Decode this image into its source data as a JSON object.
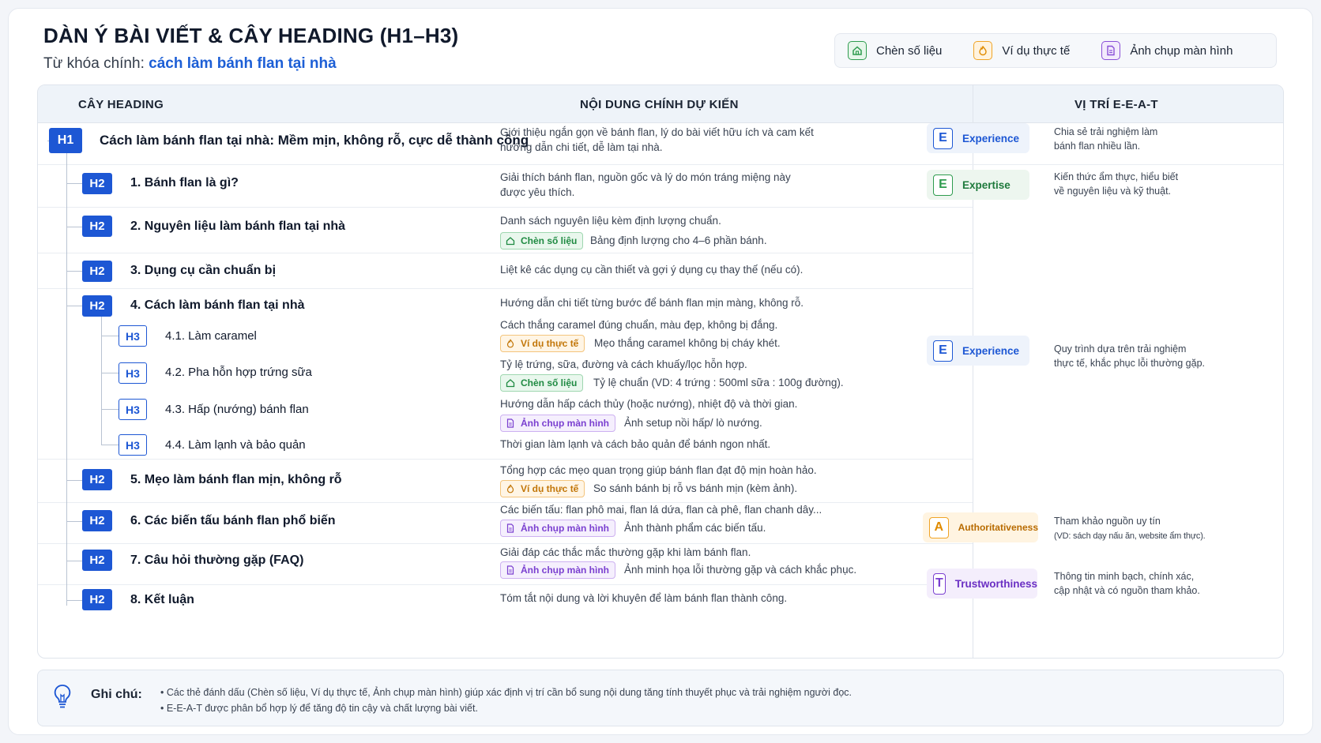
{
  "title": "DÀN Ý BÀI VIẾT & CÂY HEADING (H1–H3)",
  "keyword_label": "Từ khóa chính: ",
  "keyword": "cách làm bánh flan tại nhà",
  "legend": [
    {
      "label": "Chèn số liệu",
      "icon": "house-icon",
      "color": "#2f9c4f"
    },
    {
      "label": "Ví dụ thực tế",
      "icon": "flame-icon",
      "color": "#f0a426"
    },
    {
      "label": "Ảnh chụp màn hình",
      "icon": "document-icon",
      "color": "#8a4fd8"
    }
  ],
  "columns": {
    "heading": "CÂY HEADING",
    "content": "NỘI DUNG CHÍNH DỰ KIẾN",
    "eeat": "VỊ TRÍ E-E-A-T"
  },
  "rows": [
    {
      "level": "H1",
      "title": "Cách làm bánh flan tại nhà: Mềm mịn, không rỗ, cực dễ thành công",
      "content": [
        "Giới thiệu ngắn gọn về bánh flan, lý do bài viết hữu ích và cam kết",
        "hướng dẫn chi tiết, dễ làm tại nhà."
      ]
    },
    {
      "level": "H2",
      "title": "1. Bánh flan là gì?",
      "content": [
        "Giải thích bánh flan, nguồn gốc và lý do món tráng miệng này",
        "được yêu thích."
      ]
    },
    {
      "level": "H2",
      "title": "2. Nguyên liệu làm bánh flan tại nhà",
      "content": [
        "Danh sách nguyên liệu kèm định lượng chuẩn."
      ],
      "tag": {
        "label": "Chèn số liệu",
        "note": "Bảng định lượng cho 4–6 phần bánh."
      }
    },
    {
      "level": "H2",
      "title": "3. Dụng cụ cần chuẩn bị",
      "content": [
        "Liệt kê các dụng cụ cần thiết và gợi ý dụng cụ thay thế (nếu có)."
      ]
    },
    {
      "level": "H2",
      "title": "4. Cách làm bánh flan tại nhà",
      "content": [
        "Hướng dẫn chi tiết từng bước để bánh flan mịn màng, không rỗ."
      ]
    },
    {
      "level": "H3",
      "title": "4.1. Làm caramel",
      "content": [
        "Cách thắng caramel đúng chuẩn, màu đẹp, không bị đắng."
      ],
      "tag": {
        "label": "Ví dụ thực tế",
        "note": "Mẹo thắng caramel không bị cháy khét."
      }
    },
    {
      "level": "H3",
      "title": "4.2. Pha hỗn hợp trứng sữa",
      "content": [
        "Tỷ lệ trứng, sữa, đường và cách khuấy/lọc hỗn hợp."
      ],
      "tag": {
        "label": "Chèn số liệu",
        "note": "Tỷ lệ chuẩn (VD: 4 trứng : 500ml sữa : 100g đường)."
      }
    },
    {
      "level": "H3",
      "title": "4.3. Hấp (nướng) bánh flan",
      "content": [
        "Hướng dẫn hấp cách thủy (hoặc nướng), nhiệt độ và thời gian."
      ],
      "tag": {
        "label": "Ảnh chụp màn hình",
        "note": "Ảnh setup nồi hấp/ lò nướng."
      }
    },
    {
      "level": "H3",
      "title": "4.4. Làm lạnh và bảo quản",
      "content": [
        "Thời gian làm lạnh và cách bảo quản để bánh ngon nhất."
      ]
    },
    {
      "level": "H2",
      "title": "5. Mẹo làm bánh flan mịn, không rỗ",
      "content": [
        "Tổng hợp các mẹo quan trọng giúp bánh flan đạt độ mịn hoàn hảo."
      ],
      "tag": {
        "label": "Ví dụ thực tế",
        "note": "So sánh bánh bị rỗ vs bánh mịn (kèm ảnh)."
      }
    },
    {
      "level": "H2",
      "title": "6. Các biến tấu bánh flan phổ biến",
      "content": [
        "Các biến tấu: flan phô mai, flan lá dứa, flan cà phê, flan chanh dây..."
      ],
      "tag": {
        "label": "Ảnh chụp màn hình",
        "note": "Ảnh thành phẩm các biến tấu."
      }
    },
    {
      "level": "H2",
      "title": "7. Câu hỏi thường gặp (FAQ)",
      "content": [
        "Giải đáp các thắc mắc thường gặp khi làm bánh flan."
      ],
      "tag": {
        "label": "Ảnh chụp màn hình",
        "note": "Ảnh minh họa lỗi thường gặp và cách khắc phục."
      }
    },
    {
      "level": "H2",
      "title": "8. Kết luận",
      "content": [
        "Tóm tắt nội dung và lời khuyên để làm bánh flan thành công."
      ]
    }
  ],
  "eeat": [
    {
      "letter": "E",
      "label": "Experience",
      "desc": [
        "Chia sẻ trải nghiệm làm",
        "bánh flan nhiều lần."
      ]
    },
    {
      "letter": "E",
      "label": "Expertise",
      "desc": [
        "Kiến thức ẩm thực, hiểu biết",
        "về nguyên liệu và kỹ thuật."
      ]
    },
    {
      "letter": "E",
      "label": "Experience",
      "desc": [
        "Quy trình dựa trên trải nghiệm",
        "thực tế, khắc phục lỗi thường gặp."
      ]
    },
    {
      "letter": "A",
      "label": "Authoritativeness",
      "desc": [
        "Tham khảo nguồn uy tín",
        "(VD: sách dạy nấu ăn, website ẩm thực)."
      ]
    },
    {
      "letter": "T",
      "label": "Trustworthiness",
      "desc": [
        "Thông tin minh bạch, chính xác,",
        "cập nhật và có nguồn tham khảo."
      ]
    }
  ],
  "notes": {
    "label": "Ghi chú:",
    "items": [
      "• Các thẻ đánh dấu (Chèn số liệu, Ví dụ thực tế, Ảnh chụp màn hình) giúp xác định vị trí cần bổ sung nội dung tăng tính thuyết phục và trải nghiệm người đọc.",
      "• E-E-A-T được phân bổ hợp lý để tăng độ tin cậy và chất lượng bài viết."
    ]
  }
}
